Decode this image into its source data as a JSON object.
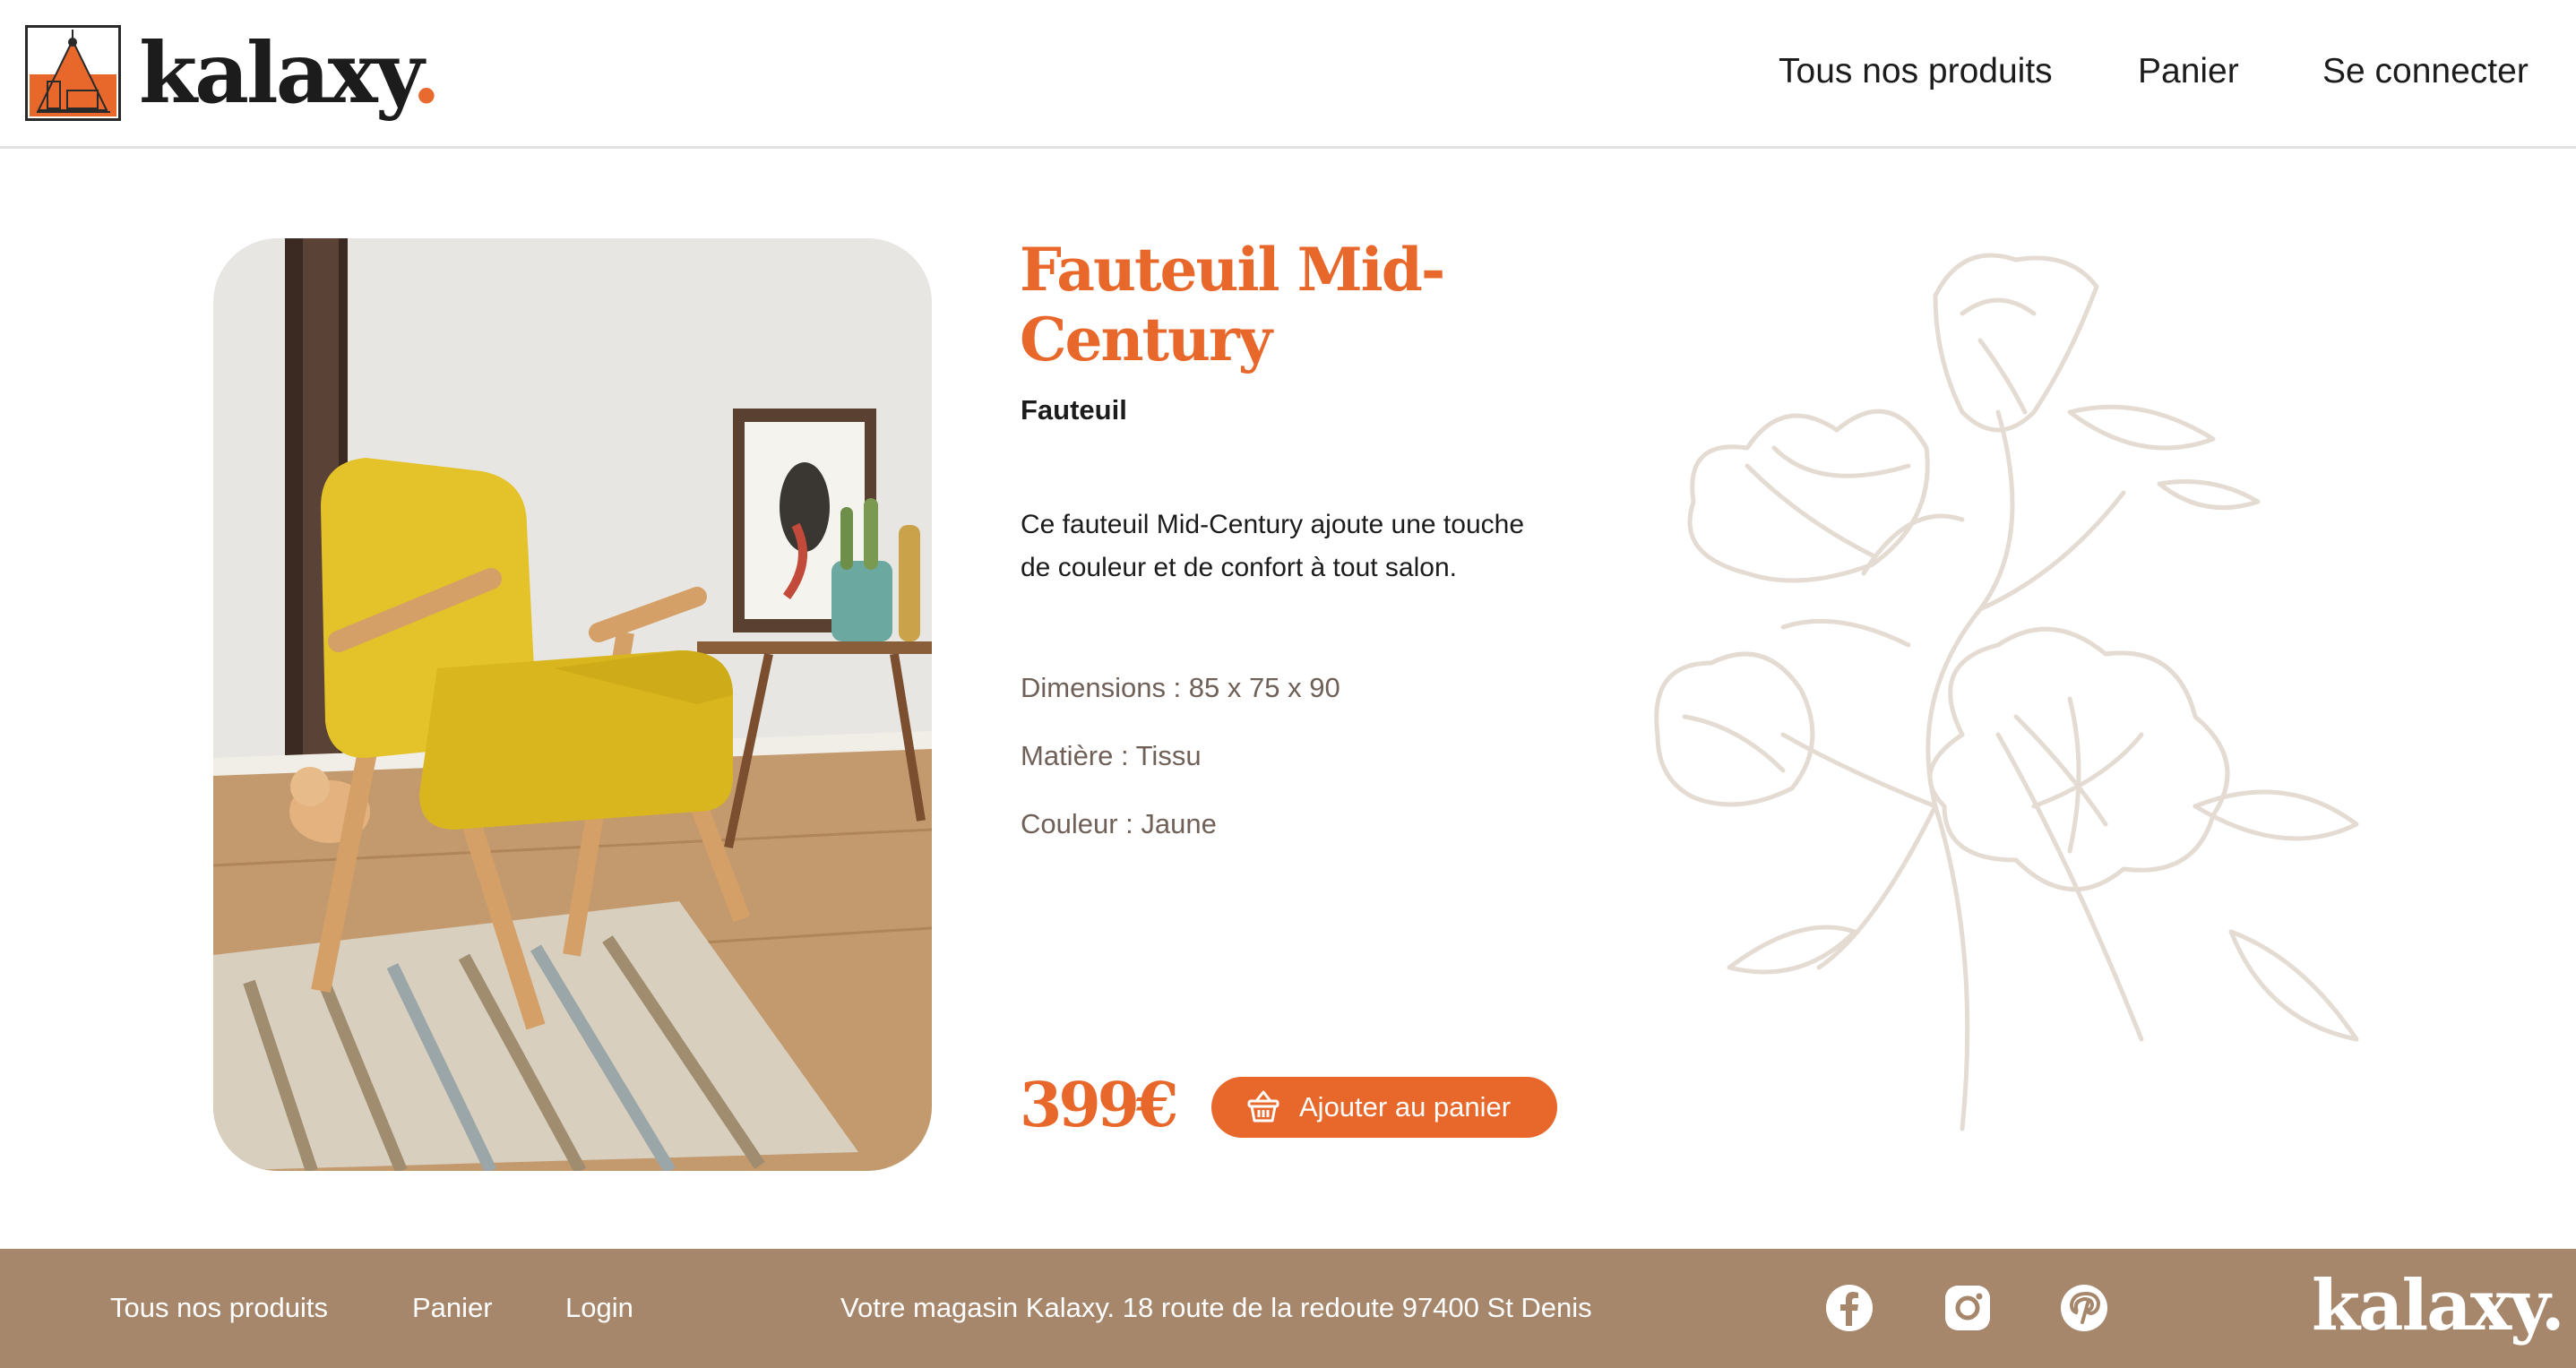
{
  "brand": {
    "name": "kalaxy",
    "dot": ".",
    "accent_color": "#e8672a"
  },
  "header": {
    "nav": [
      "Tous nos produits",
      "Panier",
      "Se connecter"
    ]
  },
  "product": {
    "title": "Fauteuil Mid-Century",
    "category": "Fauteuil",
    "description": "Ce fauteuil Mid-Century ajoute une touche de couleur et de confort à tout salon.",
    "dimensions": "Dimensions : 85 x 75 x 90",
    "material": "Matière : Tissu",
    "color": "Couleur : Jaune",
    "price": "399€",
    "add_to_cart_label": "Ajouter au panier",
    "cart_icon": "basket-icon"
  },
  "footer": {
    "links": [
      "Tous nos produits",
      "Panier",
      "Login"
    ],
    "address": "Votre magasin Kalaxy. 18 route de la redoute 97400 St Denis",
    "social_icons": [
      "facebook-icon",
      "instagram-icon",
      "pinterest-icon"
    ],
    "logo": "kalaxy."
  },
  "colors": {
    "footer_bg": "#a6876c",
    "flower_stroke": "#e4dbd3",
    "chair_yellow": "#e3c22a"
  }
}
